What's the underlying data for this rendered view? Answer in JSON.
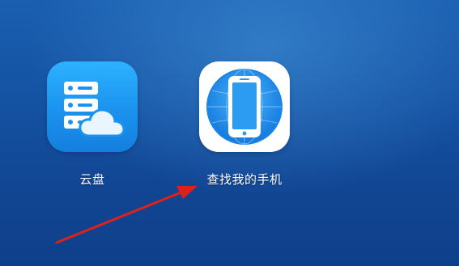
{
  "desktop": {
    "apps": [
      {
        "label": "云盘",
        "icon": "cloud-storage-icon"
      },
      {
        "label": "查找我的手机",
        "icon": "find-my-phone-icon"
      }
    ]
  },
  "colors": {
    "background": "#1553a3",
    "cloud_icon": "#1a92ee",
    "find_icon_ring": "#1e8fea",
    "arrow": "#e0201a"
  }
}
